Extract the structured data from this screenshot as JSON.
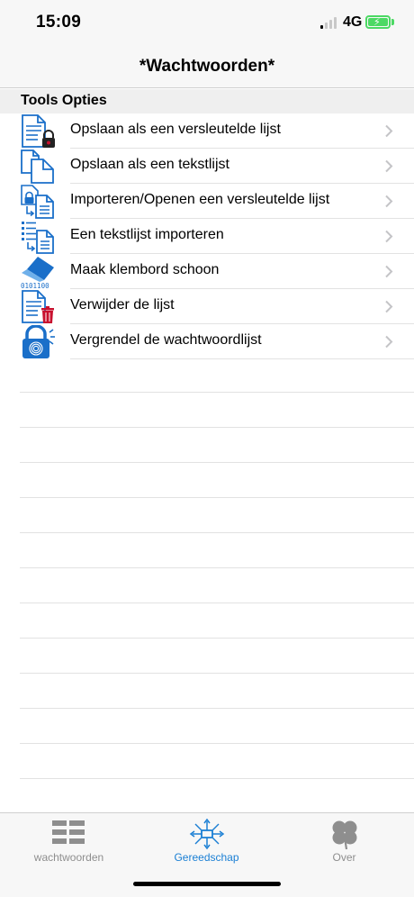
{
  "status": {
    "time": "15:09",
    "network": "4G"
  },
  "nav": {
    "title": "*Wachtwoorden*"
  },
  "section": {
    "title": "Tools Opties"
  },
  "menu": {
    "items": [
      {
        "label": "Opslaan als een versleutelde lijst",
        "icon": "encrypted-document-icon"
      },
      {
        "label": "Opslaan als een tekstlijst",
        "icon": "copy-documents-icon"
      },
      {
        "label": "Importeren/Openen een versleutelde lijst",
        "icon": "import-encrypted-icon"
      },
      {
        "label": "Een tekstlijst importeren",
        "icon": "import-text-list-icon"
      },
      {
        "label": "Maak klembord schoon",
        "icon": "eraser-icon",
        "icon_text": "0101100"
      },
      {
        "label": "Verwijder de lijst",
        "icon": "delete-list-icon"
      },
      {
        "label": "Vergrendel de wachtwoordlijst",
        "icon": "fingerprint-lock-icon"
      }
    ]
  },
  "tabs": [
    {
      "label": "wachtwoorden",
      "icon": "list-grid-icon",
      "active": false
    },
    {
      "label": "Gereedschap",
      "icon": "tools-network-icon",
      "active": true
    },
    {
      "label": "Over",
      "icon": "clover-icon",
      "active": false
    }
  ],
  "colors": {
    "accent": "#1a7fd4",
    "icon_blue": "#1a6fc9",
    "delete_red": "#c8102e",
    "battery": "#4cd964"
  }
}
